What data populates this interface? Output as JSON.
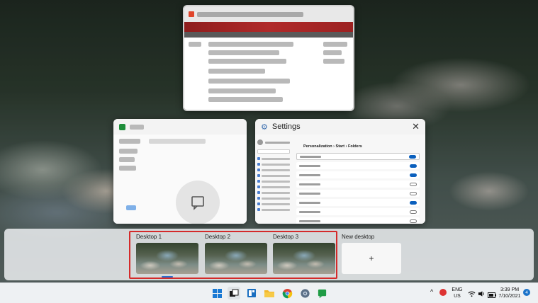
{
  "windows": {
    "settings": {
      "title": "Settings",
      "breadcrumb": "Personalization  ›  Start  ›  Folders"
    }
  },
  "desktops": [
    {
      "label": "Desktop 1"
    },
    {
      "label": "Desktop 2"
    },
    {
      "label": "Desktop 3"
    }
  ],
  "new_desktop": {
    "label": "New desktop",
    "plus": "+"
  },
  "tray": {
    "lang_line1": "ENG",
    "lang_line2": "US",
    "time": "3:39 PM",
    "date": "7/10/2021",
    "notifications": "4",
    "chevron": "^"
  },
  "colors": {
    "accent": "#1a7ad4",
    "selection_border": "#d42a2a"
  }
}
